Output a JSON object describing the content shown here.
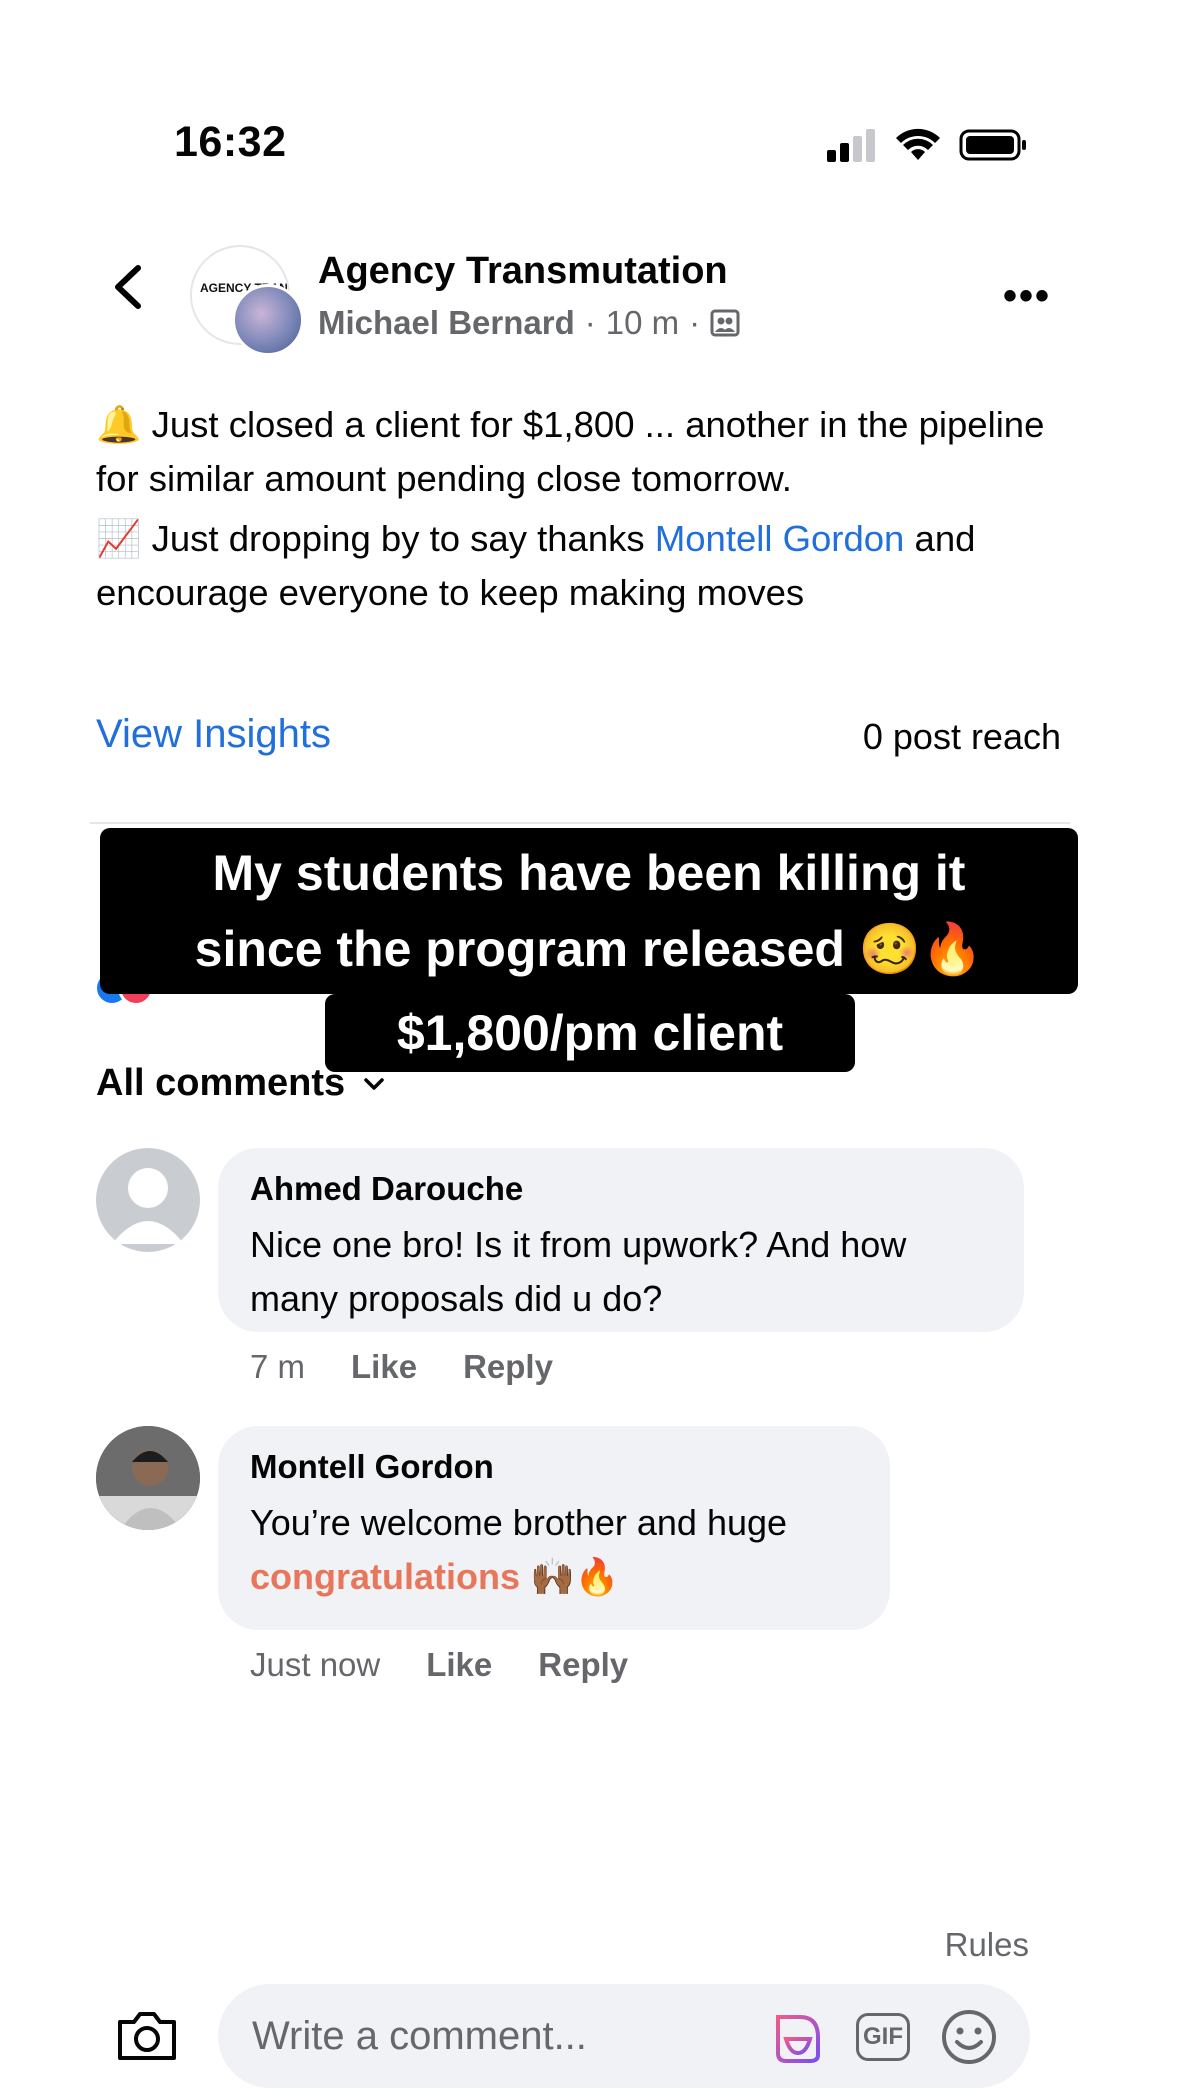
{
  "status_bar": {
    "time": "16:32"
  },
  "header": {
    "group_name": "Agency Transmutation",
    "group_logo_text": "AGENCY TRAN",
    "author": "Michael Bernard",
    "time_ago": "10 m",
    "separator": "·"
  },
  "post": {
    "line1_emoji": "🔔",
    "line1": "Just closed a client for $1,800 ... another in the pipeline for similar amount pending close tomorrow.",
    "line2_emoji": "📈",
    "line2_before": "Just dropping by to say thanks",
    "line2_mention": "Montell Gordon",
    "line2_after": "and encourage everyone to keep making moves"
  },
  "insights": {
    "link": "View Insights",
    "reach": "0 post reach"
  },
  "overlay": {
    "line1": "My students have been killing it",
    "line2": "since the program released 🥴🔥",
    "line3": "$1,800/pm client"
  },
  "comments_header": {
    "label": "All comments"
  },
  "comments": [
    {
      "name": "Ahmed Darouche",
      "text": "Nice one bro! Is it from upwork? And how many proposals did u do?",
      "time": "7 m",
      "like": "Like",
      "reply": "Reply"
    },
    {
      "name": "Montell Gordon",
      "text": "You’re welcome brother and huge",
      "highlight": "congratulations",
      "emoji": "🙌🏾🔥",
      "time": "Just now",
      "like": "Like",
      "reply": "Reply"
    }
  ],
  "footer": {
    "rules": "Rules",
    "placeholder": "Write a comment...",
    "gif": "GIF"
  },
  "colors": {
    "link": "#216fdb",
    "secondary_text": "#65676b",
    "bubble": "#f0f2f5",
    "congrats": "#e8765a"
  }
}
